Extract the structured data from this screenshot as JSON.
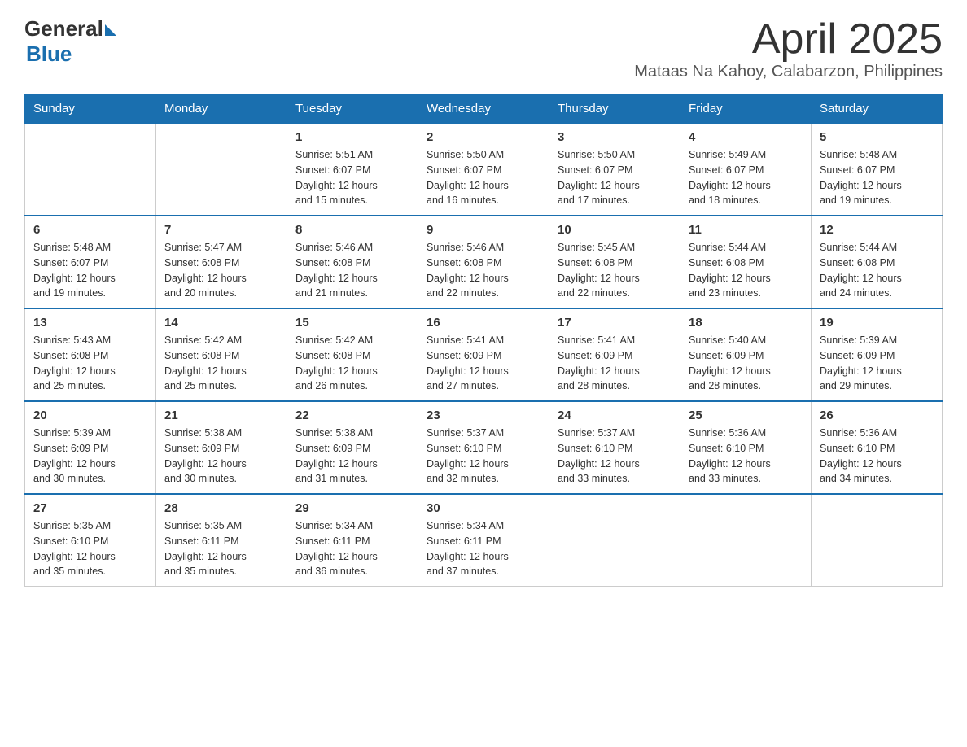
{
  "header": {
    "logo_general": "General",
    "logo_blue": "Blue",
    "title": "April 2025",
    "location": "Mataas Na Kahoy, Calabarzon, Philippines"
  },
  "weekdays": [
    "Sunday",
    "Monday",
    "Tuesday",
    "Wednesday",
    "Thursday",
    "Friday",
    "Saturday"
  ],
  "weeks": [
    [
      {
        "day": "",
        "info": ""
      },
      {
        "day": "",
        "info": ""
      },
      {
        "day": "1",
        "info": "Sunrise: 5:51 AM\nSunset: 6:07 PM\nDaylight: 12 hours\nand 15 minutes."
      },
      {
        "day": "2",
        "info": "Sunrise: 5:50 AM\nSunset: 6:07 PM\nDaylight: 12 hours\nand 16 minutes."
      },
      {
        "day": "3",
        "info": "Sunrise: 5:50 AM\nSunset: 6:07 PM\nDaylight: 12 hours\nand 17 minutes."
      },
      {
        "day": "4",
        "info": "Sunrise: 5:49 AM\nSunset: 6:07 PM\nDaylight: 12 hours\nand 18 minutes."
      },
      {
        "day": "5",
        "info": "Sunrise: 5:48 AM\nSunset: 6:07 PM\nDaylight: 12 hours\nand 19 minutes."
      }
    ],
    [
      {
        "day": "6",
        "info": "Sunrise: 5:48 AM\nSunset: 6:07 PM\nDaylight: 12 hours\nand 19 minutes."
      },
      {
        "day": "7",
        "info": "Sunrise: 5:47 AM\nSunset: 6:08 PM\nDaylight: 12 hours\nand 20 minutes."
      },
      {
        "day": "8",
        "info": "Sunrise: 5:46 AM\nSunset: 6:08 PM\nDaylight: 12 hours\nand 21 minutes."
      },
      {
        "day": "9",
        "info": "Sunrise: 5:46 AM\nSunset: 6:08 PM\nDaylight: 12 hours\nand 22 minutes."
      },
      {
        "day": "10",
        "info": "Sunrise: 5:45 AM\nSunset: 6:08 PM\nDaylight: 12 hours\nand 22 minutes."
      },
      {
        "day": "11",
        "info": "Sunrise: 5:44 AM\nSunset: 6:08 PM\nDaylight: 12 hours\nand 23 minutes."
      },
      {
        "day": "12",
        "info": "Sunrise: 5:44 AM\nSunset: 6:08 PM\nDaylight: 12 hours\nand 24 minutes."
      }
    ],
    [
      {
        "day": "13",
        "info": "Sunrise: 5:43 AM\nSunset: 6:08 PM\nDaylight: 12 hours\nand 25 minutes."
      },
      {
        "day": "14",
        "info": "Sunrise: 5:42 AM\nSunset: 6:08 PM\nDaylight: 12 hours\nand 25 minutes."
      },
      {
        "day": "15",
        "info": "Sunrise: 5:42 AM\nSunset: 6:08 PM\nDaylight: 12 hours\nand 26 minutes."
      },
      {
        "day": "16",
        "info": "Sunrise: 5:41 AM\nSunset: 6:09 PM\nDaylight: 12 hours\nand 27 minutes."
      },
      {
        "day": "17",
        "info": "Sunrise: 5:41 AM\nSunset: 6:09 PM\nDaylight: 12 hours\nand 28 minutes."
      },
      {
        "day": "18",
        "info": "Sunrise: 5:40 AM\nSunset: 6:09 PM\nDaylight: 12 hours\nand 28 minutes."
      },
      {
        "day": "19",
        "info": "Sunrise: 5:39 AM\nSunset: 6:09 PM\nDaylight: 12 hours\nand 29 minutes."
      }
    ],
    [
      {
        "day": "20",
        "info": "Sunrise: 5:39 AM\nSunset: 6:09 PM\nDaylight: 12 hours\nand 30 minutes."
      },
      {
        "day": "21",
        "info": "Sunrise: 5:38 AM\nSunset: 6:09 PM\nDaylight: 12 hours\nand 30 minutes."
      },
      {
        "day": "22",
        "info": "Sunrise: 5:38 AM\nSunset: 6:09 PM\nDaylight: 12 hours\nand 31 minutes."
      },
      {
        "day": "23",
        "info": "Sunrise: 5:37 AM\nSunset: 6:10 PM\nDaylight: 12 hours\nand 32 minutes."
      },
      {
        "day": "24",
        "info": "Sunrise: 5:37 AM\nSunset: 6:10 PM\nDaylight: 12 hours\nand 33 minutes."
      },
      {
        "day": "25",
        "info": "Sunrise: 5:36 AM\nSunset: 6:10 PM\nDaylight: 12 hours\nand 33 minutes."
      },
      {
        "day": "26",
        "info": "Sunrise: 5:36 AM\nSunset: 6:10 PM\nDaylight: 12 hours\nand 34 minutes."
      }
    ],
    [
      {
        "day": "27",
        "info": "Sunrise: 5:35 AM\nSunset: 6:10 PM\nDaylight: 12 hours\nand 35 minutes."
      },
      {
        "day": "28",
        "info": "Sunrise: 5:35 AM\nSunset: 6:11 PM\nDaylight: 12 hours\nand 35 minutes."
      },
      {
        "day": "29",
        "info": "Sunrise: 5:34 AM\nSunset: 6:11 PM\nDaylight: 12 hours\nand 36 minutes."
      },
      {
        "day": "30",
        "info": "Sunrise: 5:34 AM\nSunset: 6:11 PM\nDaylight: 12 hours\nand 37 minutes."
      },
      {
        "day": "",
        "info": ""
      },
      {
        "day": "",
        "info": ""
      },
      {
        "day": "",
        "info": ""
      }
    ]
  ]
}
